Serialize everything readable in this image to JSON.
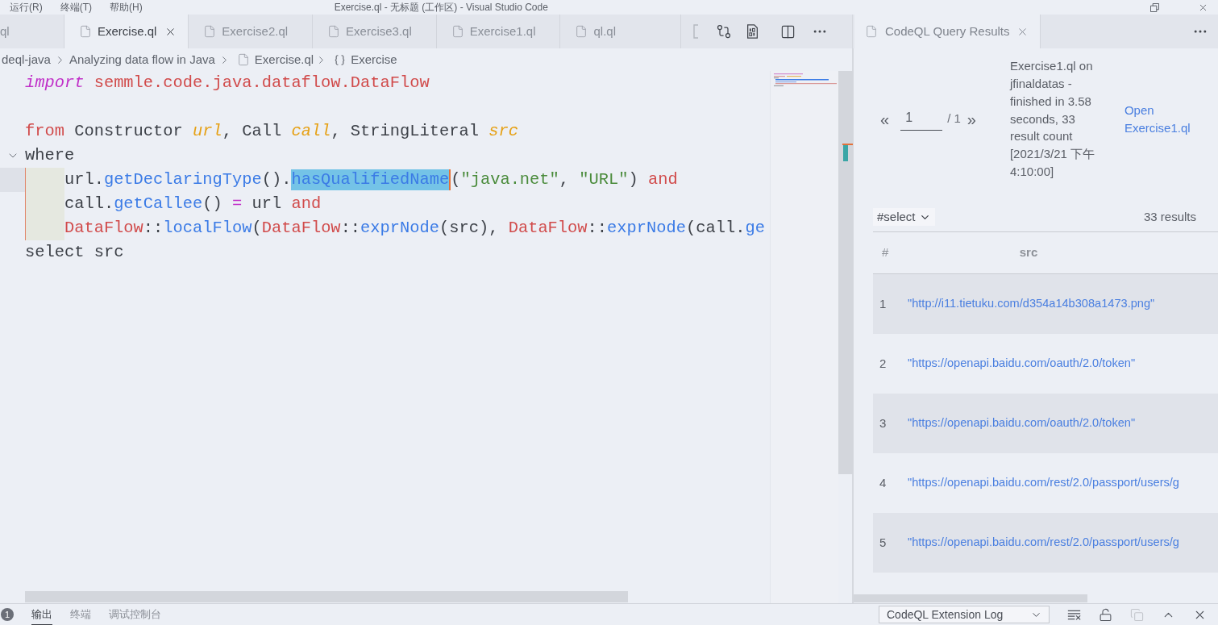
{
  "menu_bar": {
    "items": [
      "运行(R)",
      "终端(T)",
      "帮助(H)"
    ],
    "title": "Exercise.ql - 无标题 (工作区) - Visual Studio Code"
  },
  "editor": {
    "tabs": [
      {
        "label": "ql",
        "selected": false
      },
      {
        "label": "Exercise.ql",
        "selected": true
      },
      {
        "label": "Exercise2.ql",
        "selected": false
      },
      {
        "label": "Exercise3.ql",
        "selected": false
      },
      {
        "label": "Exercise1.ql",
        "selected": false
      },
      {
        "label": "ql.ql",
        "selected": false
      }
    ],
    "breadcrumb": [
      {
        "label": "deql-java",
        "kind": "folder"
      },
      {
        "label": "Analyzing data flow in Java",
        "kind": "folder"
      },
      {
        "label": "Exercise.ql",
        "kind": "file"
      },
      {
        "label": "Exercise",
        "kind": "symbol"
      }
    ],
    "lines": [
      {
        "current": false,
        "indented": false,
        "tokens": [
          {
            "text": "import ",
            "kind": "keyword",
            "selected": false
          },
          {
            "text": "semmle.code.java.dataflow.DataFlow",
            "kind": "module",
            "selected": false
          }
        ]
      },
      {
        "current": false,
        "indented": false
      },
      {
        "current": false,
        "indented": false,
        "tokens": [
          {
            "text": "from ",
            "kind": "control",
            "selected": false
          },
          {
            "text": "Constructor ",
            "kind": "type",
            "selected": false
          },
          {
            "text": "url",
            "kind": "variable",
            "selected": false
          },
          {
            "text": ", ",
            "kind": "plain",
            "selected": false
          },
          {
            "text": "Call ",
            "kind": "type",
            "selected": false
          },
          {
            "text": "call",
            "kind": "variable",
            "selected": false
          },
          {
            "text": ", ",
            "kind": "plain",
            "selected": false
          },
          {
            "text": "StringLiteral ",
            "kind": "type",
            "selected": false
          },
          {
            "text": "src",
            "kind": "variable",
            "selected": false
          }
        ]
      },
      {
        "current": false,
        "indented": false,
        "fold": {
          "expanded": true
        },
        "tokens": [
          {
            "text": "where",
            "kind": "plain",
            "selected": false
          }
        ]
      },
      {
        "current": true,
        "indented": true,
        "tokens": [
          {
            "text": "url.",
            "kind": "plain",
            "selected": false
          },
          {
            "text": "getDeclaringType",
            "kind": "method",
            "selected": false
          },
          {
            "text": "().",
            "kind": "plain",
            "selected": false
          },
          {
            "text": "hasQualifiedName",
            "kind": "method",
            "selected": true
          },
          {
            "text": "(",
            "kind": "plain",
            "selected": false
          },
          {
            "text": "\"java.net\"",
            "kind": "string",
            "selected": false
          },
          {
            "text": ", ",
            "kind": "plain",
            "selected": false
          },
          {
            "text": "\"URL\"",
            "kind": "string",
            "selected": false
          },
          {
            "text": ") ",
            "kind": "plain",
            "selected": false
          },
          {
            "text": "and",
            "kind": "control",
            "selected": false
          }
        ]
      },
      {
        "current": false,
        "indented": true,
        "tokens": [
          {
            "text": "call.",
            "kind": "plain",
            "selected": false
          },
          {
            "text": "getCallee",
            "kind": "method",
            "selected": false
          },
          {
            "text": "() ",
            "kind": "plain",
            "selected": false
          },
          {
            "text": "=",
            "kind": "operator",
            "selected": false
          },
          {
            "text": " url ",
            "kind": "plain",
            "selected": false
          },
          {
            "text": "and",
            "kind": "control",
            "selected": false
          }
        ]
      },
      {
        "current": false,
        "indented": true,
        "tokens": [
          {
            "text": "DataFlow",
            "kind": "module",
            "selected": false
          },
          {
            "text": "::",
            "kind": "plain",
            "selected": false
          },
          {
            "text": "localFlow",
            "kind": "method",
            "selected": false
          },
          {
            "text": "(",
            "kind": "plain",
            "selected": false
          },
          {
            "text": "DataFlow",
            "kind": "module",
            "selected": false
          },
          {
            "text": "::",
            "kind": "plain",
            "selected": false
          },
          {
            "text": "exprNode",
            "kind": "method",
            "selected": false
          },
          {
            "text": "(src), ",
            "kind": "plain",
            "selected": false
          },
          {
            "text": "DataFlow",
            "kind": "module",
            "selected": false
          },
          {
            "text": "::",
            "kind": "plain",
            "selected": false
          },
          {
            "text": "exprNode",
            "kind": "method",
            "selected": false
          },
          {
            "text": "(call.",
            "kind": "plain",
            "selected": false
          },
          {
            "text": "ge",
            "kind": "method",
            "selected": false
          }
        ]
      },
      {
        "current": false,
        "indented": false,
        "tokens": [
          {
            "text": "select src",
            "kind": "plain",
            "selected": false
          }
        ]
      }
    ]
  },
  "results_panel": {
    "tab": {
      "label": "CodeQL Query Results"
    },
    "pager": {
      "previous": "«",
      "page": "1",
      "total": "/ 1",
      "next": "»"
    },
    "summary": "Exercise1.ql on jfinaldatas - finished in 3.58 seconds, 33 result count [2021/3/21 下午4:10:00]",
    "open_link": "Open Exercise1.ql",
    "result_set": "#select",
    "result_count": "33 results",
    "columns": [
      "#",
      "src"
    ],
    "rows": [
      {
        "index": "1",
        "src": "\"http://i11.tietuku.com/d354a14b308a1473.png\""
      },
      {
        "index": "2",
        "src": "\"https://openapi.baidu.com/oauth/2.0/token\""
      },
      {
        "index": "3",
        "src": "\"https://openapi.baidu.com/oauth/2.0/token\""
      },
      {
        "index": "4",
        "src": "\"https://openapi.baidu.com/rest/2.0/passport/users/g"
      },
      {
        "index": "5",
        "src": "\"https://openapi.baidu.com/rest/2.0/passport/users/g"
      }
    ]
  },
  "bottom_panel": {
    "badge": "1",
    "tabs": [
      {
        "label": "输出",
        "selected": true
      },
      {
        "label": "终端",
        "selected": false
      },
      {
        "label": "调试控制台",
        "selected": false
      }
    ],
    "channel": "CodeQL Extension Log",
    "actions": [
      {
        "kind": "clear",
        "disabled": false
      },
      {
        "kind": "lock",
        "disabled": false
      },
      {
        "kind": "copy",
        "disabled": true
      },
      {
        "kind": "maximize",
        "disabled": false
      },
      {
        "kind": "close",
        "disabled": false
      }
    ]
  }
}
